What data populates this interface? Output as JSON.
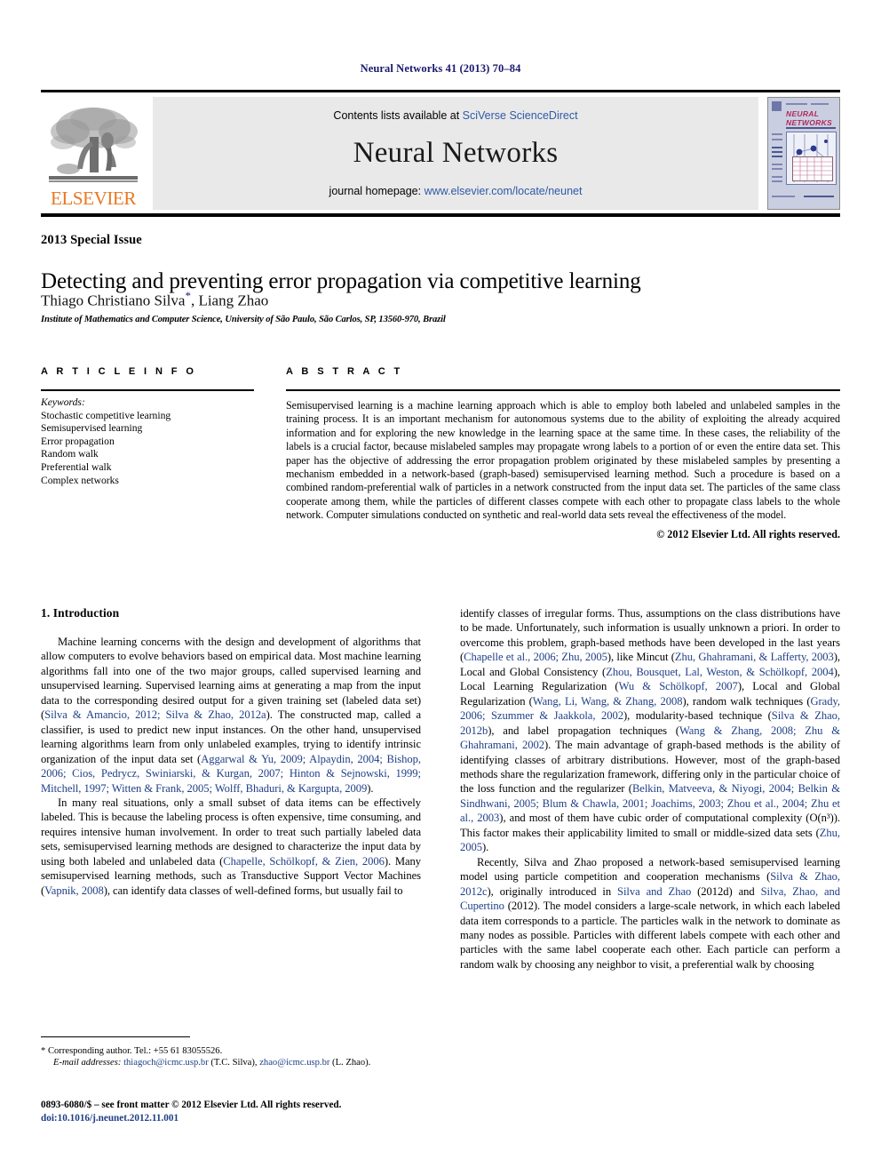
{
  "running_head": "Neural Networks 41 (2013) 70–84",
  "masthead": {
    "contents_prefix": "Contents lists available at ",
    "contents_link": "SciVerse ScienceDirect",
    "journal_name": "Neural Networks",
    "homepage_prefix": "journal homepage: ",
    "homepage_url": "www.elsevier.com/locate/neunet",
    "publisher_wordmark": "ELSEVIER",
    "publisher_color": "#E87722",
    "link_color": "#2f5aa8",
    "cover_title_line1": "NEURAL",
    "cover_title_line2": "NETWORKS",
    "cover_title_color": "#b3285a"
  },
  "title_block": {
    "special_issue": "2013 Special Issue",
    "title": "Detecting and preventing error propagation via competitive learning",
    "authors": "Thiago Christiano Silva",
    "author_marker": "*",
    "authors_rest": ", Liang Zhao",
    "affiliation": "Institute of Mathematics and Computer Science, University of São Paulo, São Carlos, SP, 13560-970, Brazil"
  },
  "article_info": {
    "heading": "A R T I C L E   I N F O",
    "keywords_label": "Keywords:",
    "keywords": [
      "Stochastic competitive learning",
      "Semisupervised learning",
      "Error propagation",
      "Random walk",
      "Preferential walk",
      "Complex networks"
    ]
  },
  "abstract": {
    "heading": "A B S T R A C T",
    "text": "Semisupervised learning is a machine learning approach which is able to employ both labeled and unlabeled samples in the training process. It is an important mechanism for autonomous systems due to the ability of exploiting the already acquired information and for exploring the new knowledge in the learning space at the same time. In these cases, the reliability of the labels is a crucial factor, because mislabeled samples may propagate wrong labels to a portion of or even the entire data set. This paper has the objective of addressing the error propagation problem originated by these mislabeled samples by presenting a mechanism embedded in a network-based (graph-based) semisupervised learning method. Such a procedure is based on a combined random-preferential walk of particles in a network constructed from the input data set. The particles of the same class cooperate among them, while the particles of different classes compete with each other to propagate class labels to the whole network. Computer simulations conducted on synthetic and real-world data sets reveal the effectiveness of the model.",
    "copyright": "© 2012 Elsevier Ltd. All rights reserved."
  },
  "body": {
    "section_number_title": "1. Introduction",
    "left_paragraphs": [
      {
        "segments": [
          {
            "t": "Machine learning concerns with the design and development of algorithms that allow computers to evolve behaviors based on empirical data. Most machine learning algorithms fall into one of the two major groups, called supervised learning and unsupervised learning. Supervised learning aims at generating a map from the input data to the corresponding desired output for a given training set (labeled data set) (",
            "c": false
          },
          {
            "t": "Silva & Amancio, 2012; Silva & Zhao, 2012a",
            "c": true
          },
          {
            "t": "). The constructed map, called a classifier, is used to predict new input instances. On the other hand, unsupervised learning algorithms learn from only unlabeled examples, trying to identify intrinsic organization of the input data set (",
            "c": false
          },
          {
            "t": "Aggarwal & Yu, 2009; Alpaydin, 2004; Bishop, 2006; Cios, Pedrycz, Swiniarski, & Kurgan, 2007; Hinton & Sejnowski, 1999; Mitchell, 1997; Witten & Frank, 2005; Wolff, Bhaduri, & Kargupta, 2009",
            "c": true
          },
          {
            "t": ").",
            "c": false
          }
        ]
      },
      {
        "segments": [
          {
            "t": "In many real situations, only a small subset of data items can be effectively labeled. This is because the labeling process is often expensive, time consuming, and requires intensive human involvement. In order to treat such partially labeled data sets, semisupervised learning methods are designed to characterize the input data by using both labeled and unlabeled data (",
            "c": false
          },
          {
            "t": "Chapelle, Schölkopf, & Zien, 2006",
            "c": true
          },
          {
            "t": "). Many semisupervised learning methods, such as Transductive Support Vector Machines (",
            "c": false
          },
          {
            "t": "Vapnik, 2008",
            "c": true
          },
          {
            "t": "), can identify data classes of well-defined forms, but usually fail to",
            "c": false
          }
        ]
      }
    ],
    "right_paragraphs": [
      {
        "segments": [
          {
            "t": "identify classes of irregular forms. Thus, assumptions on the class distributions have to be made. Unfortunately, such information is usually unknown a priori. In order to overcome this problem, graph-based methods have been developed in the last years (",
            "c": false
          },
          {
            "t": "Chapelle et al., 2006; Zhu, 2005",
            "c": true
          },
          {
            "t": "), like Mincut (",
            "c": false
          },
          {
            "t": "Zhu, Ghahramani, & Lafferty, 2003",
            "c": true
          },
          {
            "t": "), Local and Global Consistency (",
            "c": false
          },
          {
            "t": "Zhou, Bousquet, Lal, Weston, & Schölkopf, 2004",
            "c": true
          },
          {
            "t": "), Local Learning Regularization (",
            "c": false
          },
          {
            "t": "Wu & Schölkopf, 2007",
            "c": true
          },
          {
            "t": "), Local and Global Regularization (",
            "c": false
          },
          {
            "t": "Wang, Li, Wang, & Zhang, 2008",
            "c": true
          },
          {
            "t": "), random walk techniques (",
            "c": false
          },
          {
            "t": "Grady, 2006; Szummer & Jaakkola, 2002",
            "c": true
          },
          {
            "t": "), modularity-based technique (",
            "c": false
          },
          {
            "t": "Silva & Zhao, 2012b",
            "c": true
          },
          {
            "t": "), and label propagation techniques (",
            "c": false
          },
          {
            "t": "Wang & Zhang, 2008; Zhu & Ghahramani, 2002",
            "c": true
          },
          {
            "t": "). The main advantage of graph-based methods is the ability of identifying classes of arbitrary distributions. However, most of the graph-based methods share the regularization framework, differing only in the particular choice of the loss function and the regularizer (",
            "c": false
          },
          {
            "t": "Belkin, Matveeva, & Niyogi, 2004; Belkin & Sindhwani, 2005; Blum & Chawla, 2001; Joachims, 2003; Zhou et al., 2004; Zhu et al., 2003",
            "c": true
          },
          {
            "t": "), and most of them have cubic order of computational complexity (O(n³)). This factor makes their applicability limited to small or middle-sized data sets (",
            "c": false
          },
          {
            "t": "Zhu, 2005",
            "c": true
          },
          {
            "t": ").",
            "c": false
          }
        ]
      },
      {
        "segments": [
          {
            "t": "Recently, Silva and Zhao proposed a network-based semisupervised learning model using particle competition and cooperation mechanisms (",
            "c": false
          },
          {
            "t": "Silva & Zhao, 2012c",
            "c": true
          },
          {
            "t": "), originally introduced in ",
            "c": false
          },
          {
            "t": "Silva and Zhao",
            "c": true
          },
          {
            "t": " (2012d) and ",
            "c": false
          },
          {
            "t": "Silva, Zhao, and Cupertino",
            "c": true
          },
          {
            "t": " (2012). The model considers a large-scale network, in which each labeled data item corresponds to a particle. The particles walk in the network to dominate as many nodes as possible. Particles with different labels compete with each other and particles with the same label cooperate each other. Each particle can perform a random walk by choosing any neighbor to visit, a preferential walk by choosing",
            "c": false
          }
        ]
      }
    ]
  },
  "footnotes": {
    "corresponding": "*  Corresponding author. Tel.: +55 61 83055526.",
    "email_label": "E-mail addresses:",
    "email_1": "thiagoch@icmc.usp.br",
    "email_1_owner": " (T.C. Silva), ",
    "email_2": "zhao@icmc.usp.br",
    "email_2_owner": " (L. Zhao).",
    "imprint": "0893-6080/$ – see front matter © 2012 Elsevier Ltd. All rights reserved.",
    "doi": "doi:10.1016/j.neunet.2012.11.001"
  }
}
